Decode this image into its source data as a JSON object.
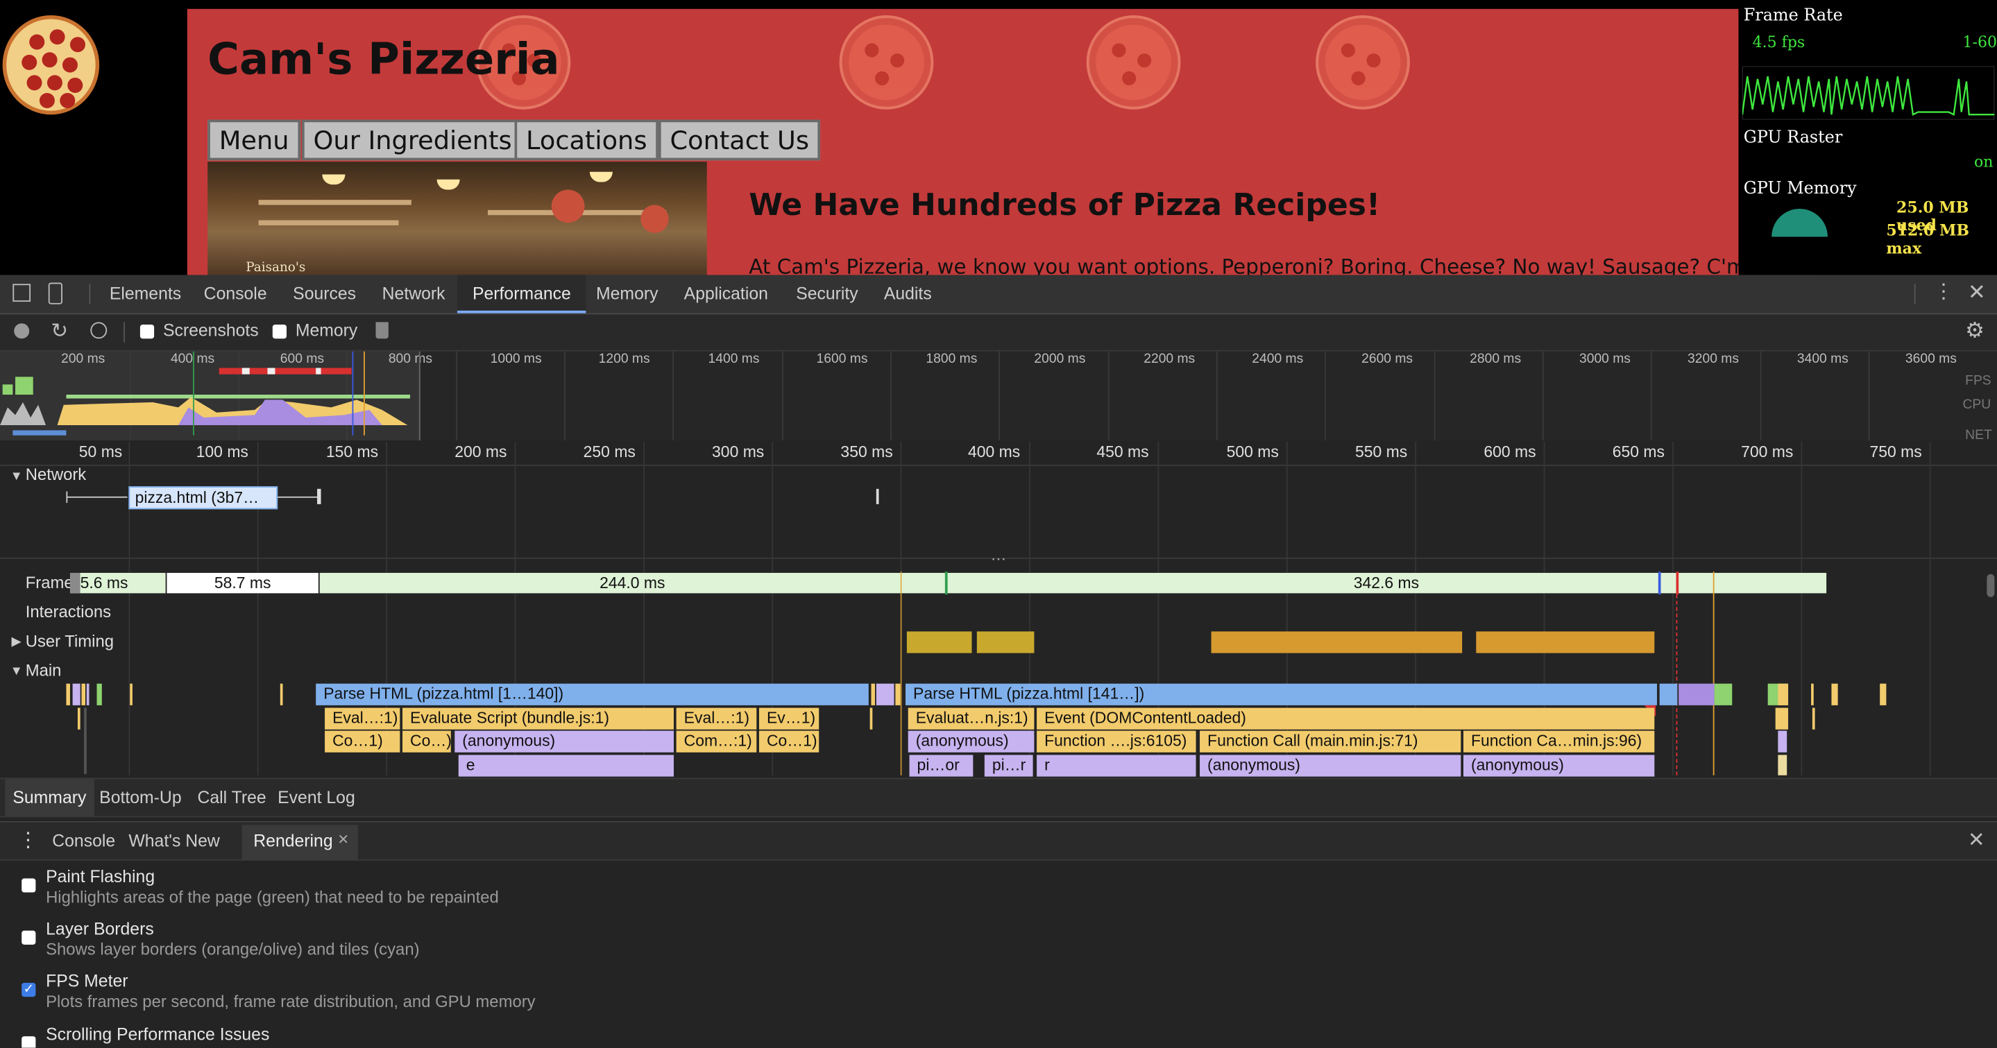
{
  "website": {
    "title": "Cam's Pizzeria",
    "nav": [
      "Menu",
      "Our Ingredients",
      "Locations",
      "Contact Us"
    ],
    "hero_caption": "Paisano's",
    "headline": "We Have Hundreds of Pizza Recipes!",
    "intro": "At Cam's Pizzeria, we know you want options. Pepperoni? Boring. Cheese? No way! Sausage? C'mon, let's"
  },
  "fps_meter": {
    "frame_rate_label": "Frame Rate",
    "fps_value": "4.5 fps",
    "range": "1-60",
    "gpu_raster_label": "GPU Raster",
    "gpu_raster_value": "on",
    "gpu_memory_label": "GPU Memory",
    "memory_used": "25.0 MB used",
    "memory_max": "512.0 MB max"
  },
  "devtools": {
    "tabs": [
      "Elements",
      "Console",
      "Sources",
      "Network",
      "Performance",
      "Memory",
      "Application",
      "Security",
      "Audits"
    ],
    "active_tab": "Performance",
    "toolbar": {
      "screenshots": "Screenshots",
      "memory": "Memory"
    },
    "overview_ticks": [
      "200 ms",
      "400 ms",
      "600 ms",
      "800 ms",
      "1000 ms",
      "1200 ms",
      "1400 ms",
      "1600 ms",
      "1800 ms",
      "2000 ms",
      "2200 ms",
      "2400 ms",
      "2600 ms",
      "2800 ms",
      "3000 ms",
      "3200 ms",
      "3400 ms",
      "3600 ms"
    ],
    "overview_labels": [
      "FPS",
      "CPU",
      "NET"
    ],
    "ruler_ticks": [
      "50 ms",
      "100 ms",
      "150 ms",
      "200 ms",
      "250 ms",
      "300 ms",
      "350 ms",
      "400 ms",
      "450 ms",
      "500 ms",
      "550 ms",
      "600 ms",
      "650 ms",
      "700 ms",
      "750 ms"
    ],
    "tracks": {
      "network": "Network",
      "network_request": "pizza.html (3b7…",
      "frames": "Frames",
      "interactions": "Interactions",
      "user_timing": "User Timing",
      "main": "Main"
    },
    "frames": [
      "5.6 ms",
      "58.7 ms",
      "244.0 ms",
      "342.6 ms"
    ],
    "main_blocks": {
      "parse1": "Parse HTML (pizza.html [1…140])",
      "parse2": "Parse HTML (pizza.html [141…])",
      "eval1": "Eval…:1)",
      "eval_bundle": "Evaluate Script (bundle.js:1)",
      "eval2": "Eval…:1)",
      "eval3": "Ev…1)",
      "eval4": "Evaluat…n.js:1)",
      "event_dcl": "Event (DOMContentLoaded)",
      "co1": "Co…1)",
      "co2": "Co…)",
      "anon1": "(anonymous)",
      "com1": "Com…:1)",
      "co3": "Co…1)",
      "anon2": "(anonymous)",
      "fn1": "Function ….js:6105)",
      "fn_call": "Function Call (main.min.js:71)",
      "fn2": "Function Ca…min.js:96)",
      "e": "e",
      "pi1": "pi…or",
      "pi2": "pi…r",
      "r": "r",
      "anon3": "(anonymous)",
      "anon4": "(anonymous)"
    },
    "bottom_tabs": [
      "Summary",
      "Bottom-Up",
      "Call Tree",
      "Event Log"
    ],
    "active_bottom_tab": "Summary"
  },
  "drawer": {
    "tabs": [
      "Console",
      "What's New",
      "Rendering"
    ],
    "active_tab": "Rendering",
    "options": [
      {
        "title": "Paint Flashing",
        "desc": "Highlights areas of the page (green) that need to be repainted",
        "checked": false
      },
      {
        "title": "Layer Borders",
        "desc": "Shows layer borders (orange/olive) and tiles (cyan)",
        "checked": false
      },
      {
        "title": "FPS Meter",
        "desc": "Plots frames per second, frame rate distribution, and GPU memory",
        "checked": true
      },
      {
        "title": "Scrolling Performance Issues",
        "desc": "",
        "checked": false
      }
    ]
  },
  "colors": {
    "site_bg": "#c33a3a",
    "parse_html": "#7fb0ec",
    "scripting": "#f2cb6c",
    "function": "#c7b3f0",
    "frame_ok": "#dff3d6",
    "accent": "#7cacf8"
  }
}
